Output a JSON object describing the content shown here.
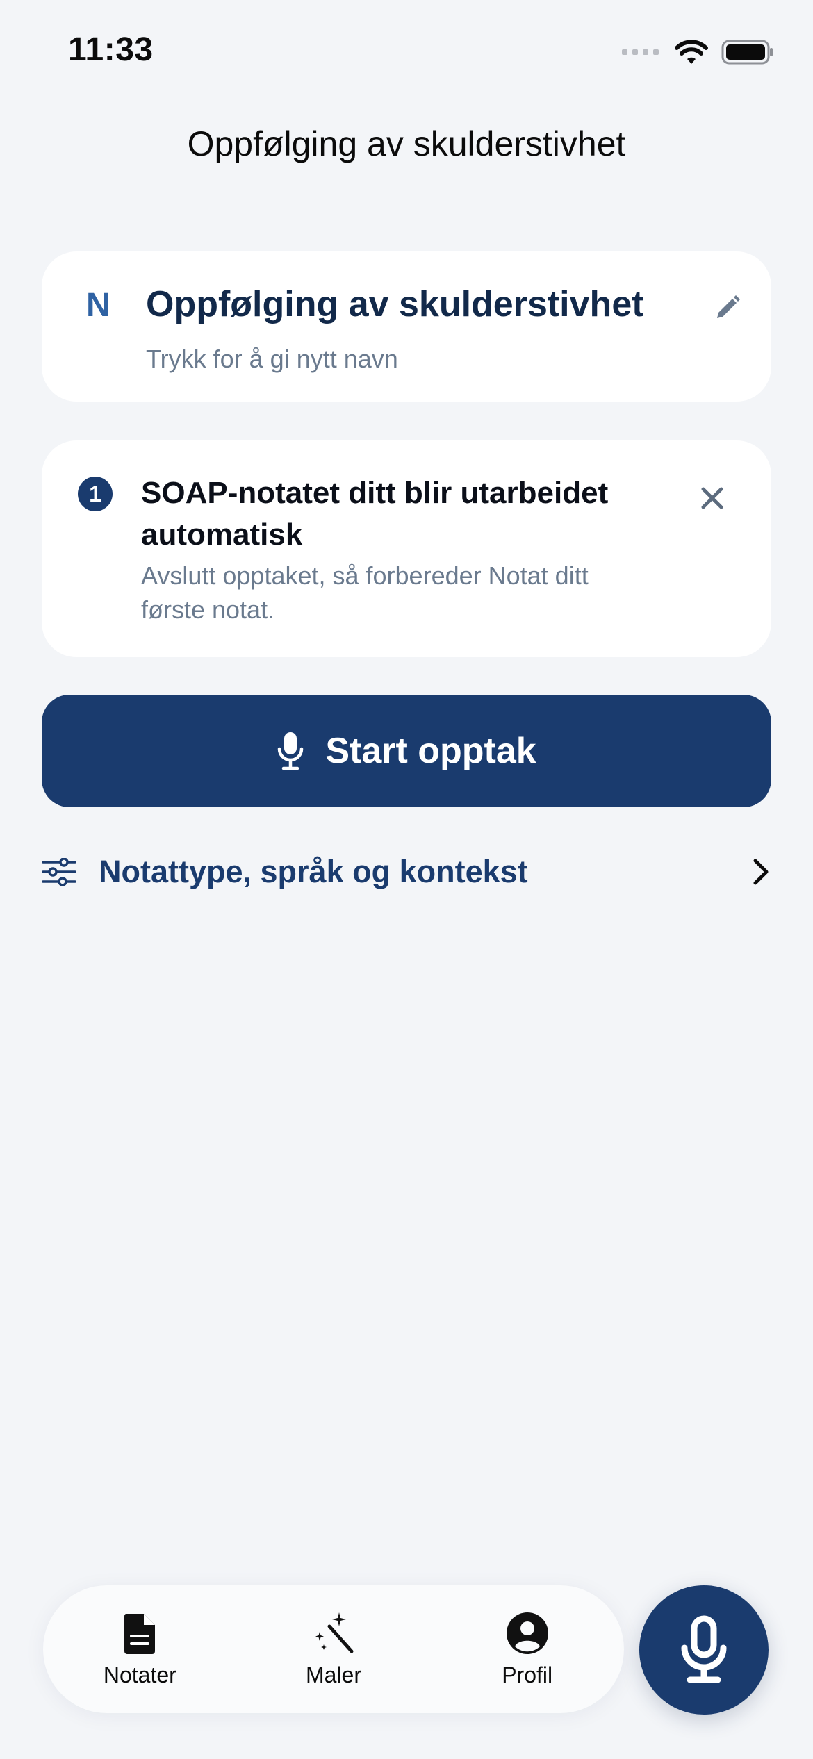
{
  "status_bar": {
    "time": "11:33"
  },
  "header": {
    "title": "Oppfølging av skulderstivhet"
  },
  "note_card": {
    "badge": "N",
    "title": "Oppfølging av skulderstivhet",
    "subtitle": "Trykk for å gi nytt navn",
    "edit_icon": "pencil-icon"
  },
  "info_card": {
    "step_number": "1",
    "title": "SOAP-notatet ditt blir utarbeidet automatisk",
    "text": "Avslutt opptaket, så forbereder Notat ditt første notat.",
    "close_icon": "close-icon"
  },
  "start_button": {
    "label": "Start opptak",
    "icon": "microphone-icon"
  },
  "settings_row": {
    "label": "Notattype, språk og kontekst",
    "icon": "sliders-icon",
    "chevron": "chevron-right-icon"
  },
  "tab_bar": {
    "tabs": [
      {
        "label": "Notater",
        "icon": "document-icon"
      },
      {
        "label": "Maler",
        "icon": "magic-wand-icon"
      },
      {
        "label": "Profil",
        "icon": "profile-icon"
      }
    ]
  },
  "fab": {
    "icon": "microphone-icon"
  },
  "colors": {
    "background": "#f3f5f8",
    "card": "#ffffff",
    "primary": "#1a3b6e",
    "badge_blue": "#2f62a3",
    "muted_text": "#6a7a8e"
  }
}
